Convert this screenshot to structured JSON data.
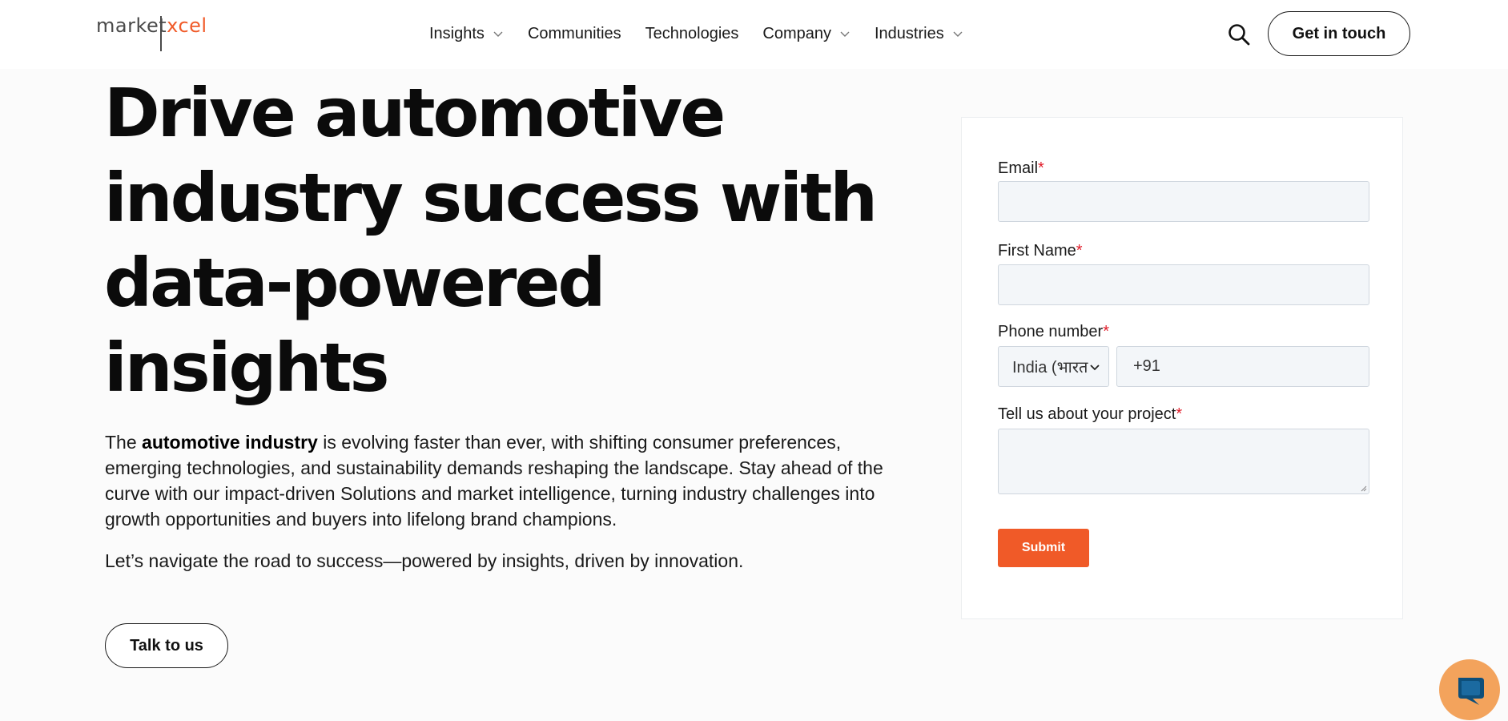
{
  "header": {
    "logo": {
      "part1": "market",
      "part2": "xcel"
    },
    "nav": [
      {
        "label": "Insights",
        "has_dropdown": true
      },
      {
        "label": "Communities",
        "has_dropdown": false
      },
      {
        "label": "Technologies",
        "has_dropdown": false
      },
      {
        "label": "Company",
        "has_dropdown": true
      },
      {
        "label": "Industries",
        "has_dropdown": true
      }
    ],
    "search_icon": "search-icon",
    "cta_label": "Get in touch"
  },
  "hero": {
    "title_lines": [
      "Drive automotive",
      "industry success with",
      "data-powered",
      "insights"
    ],
    "para1_prefix": "The ",
    "para1_bold": "automotive industry",
    "para1_rest": " is evolving faster than ever, with shifting consumer preferences, emerging technologies, and sustainability demands reshaping the landscape. Stay ahead of the curve with our impact-driven Solutions and market intelligence, turning industry challenges into growth opportunities and buyers into lifelong brand champions.",
    "para2": "Let’s navigate the road to success—powered by insights, driven by innovation.",
    "cta_label": "Talk to us"
  },
  "form": {
    "email_label": "Email",
    "first_name_label": "First Name",
    "phone_label": "Phone number",
    "country_value": "India (भारत",
    "phone_value": "+91",
    "project_label": "Tell us about your project",
    "required_mark": "*",
    "submit_label": "Submit"
  },
  "colors": {
    "accent": "#f05a28",
    "required": "#e11d2a",
    "chat_bubble": "#f3a35c"
  },
  "chat_icon": "chat-icon"
}
